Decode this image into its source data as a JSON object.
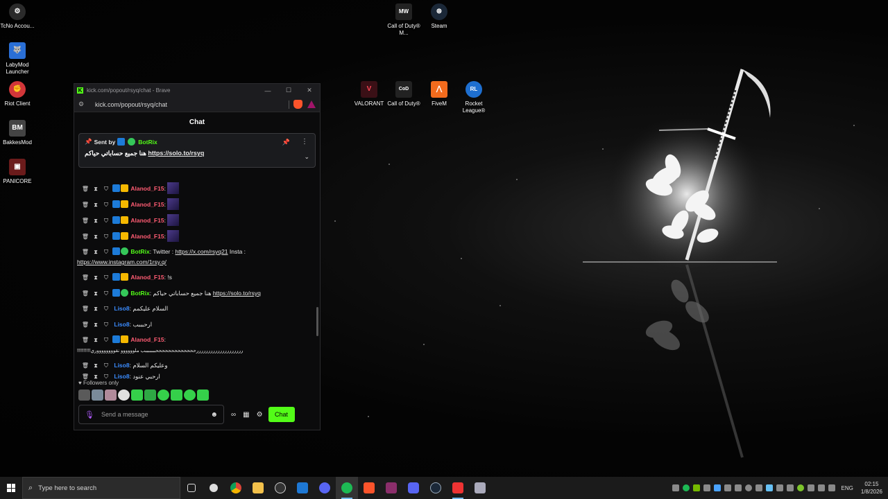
{
  "desktop_icons": [
    {
      "label": "TcNo Accou...",
      "icon": "tcno-icon",
      "color": "#2b2b2b",
      "glyph": "⚙"
    },
    {
      "label": "LabyMod Launcher",
      "icon": "labymod-icon",
      "color": "#2a6fd6",
      "glyph": "🐺"
    },
    {
      "label": "Riot Client",
      "icon": "riot-icon",
      "color": "#d13639",
      "glyph": "✊"
    },
    {
      "label": "BakkesMod",
      "icon": "bakkesmod-icon",
      "color": "#444",
      "glyph": "BM"
    },
    {
      "label": "PANICORE",
      "icon": "panicore-icon",
      "color": "#6b1b1b",
      "glyph": "▣"
    },
    {
      "label": "Call of Duty® M...",
      "icon": "cod-mw-icon",
      "color": "#222",
      "glyph": "MW"
    },
    {
      "label": "Steam",
      "icon": "steam-icon",
      "color": "#1b2838",
      "glyph": "⊛"
    },
    {
      "label": "VALORANT",
      "icon": "valorant-icon",
      "color": "#3a1016",
      "glyph": "V"
    },
    {
      "label": "Call of Duty®",
      "icon": "cod-icon",
      "color": "#222",
      "glyph": "CoD"
    },
    {
      "label": "FiveM",
      "icon": "fivem-icon",
      "color": "#f26b1d",
      "glyph": "⋀"
    },
    {
      "label": "Rocket League®",
      "icon": "rocket-league-icon",
      "color": "#1e6fd0",
      "glyph": "RL"
    }
  ],
  "browser": {
    "title": "kick.com/popout/rsyq/chat - Brave",
    "url": "kick.com/popout/rsyq/chat",
    "minimize": "—",
    "maximize": "☐",
    "close": "✕"
  },
  "chat": {
    "header": "Chat",
    "pinned": {
      "sent_by": "Sent by",
      "user": "BotRix",
      "text": "هنا جميع حساباتي حياكم",
      "link": "https://solo.to/rsyq"
    },
    "messages": [
      {
        "user": "Alanod_F15",
        "text": "",
        "link": "",
        "cont": ""
      },
      {
        "user": "Alanod_F15",
        "text": "",
        "link": "",
        "cont": ""
      },
      {
        "user": "Alanod_F15",
        "text": "",
        "link": "",
        "cont": ""
      },
      {
        "user": "Alanod_F15",
        "text": "",
        "link": "",
        "cont": ""
      },
      {
        "user": "BotRix",
        "text": " Twitter : ",
        "link": "https://x.com/rsyq21",
        "text2": " Insta :",
        "cont": "https://www.instagram.com/1rsy.q/"
      },
      {
        "user": "Alanod_F15",
        "text": " !s",
        "link": "",
        "cont": ""
      },
      {
        "user": "BotRix",
        "text": " هنا جميع حساباتي حياكم ",
        "link": "https://solo.to/rsyq",
        "cont": ""
      },
      {
        "user": "Liso8",
        "text": " السلام عليكمم",
        "link": "",
        "cont": ""
      },
      {
        "user": "Liso8",
        "text": " ارحبببب",
        "link": "",
        "cont": ""
      },
      {
        "user": "Alanod_F15",
        "text": "",
        "link": "",
        "cont": "!!!!!!!!!!ررررررررررررررررررررحححححححححححححبببببببب ملوووووو نقووووووووري"
      },
      {
        "user": "Liso8",
        "text": " وعليكم السلام",
        "link": "",
        "cont": ""
      },
      {
        "user": "Liso8",
        "text": " ارحبي عنود",
        "link": "",
        "cont": ""
      }
    ],
    "followers_only": "Followers only",
    "input_placeholder": "Send a message",
    "send_label": "Chat"
  },
  "taskbar": {
    "search_placeholder": "Type here to search",
    "lang": "ENG",
    "time": "02:15",
    "date": "1/8/2026"
  }
}
